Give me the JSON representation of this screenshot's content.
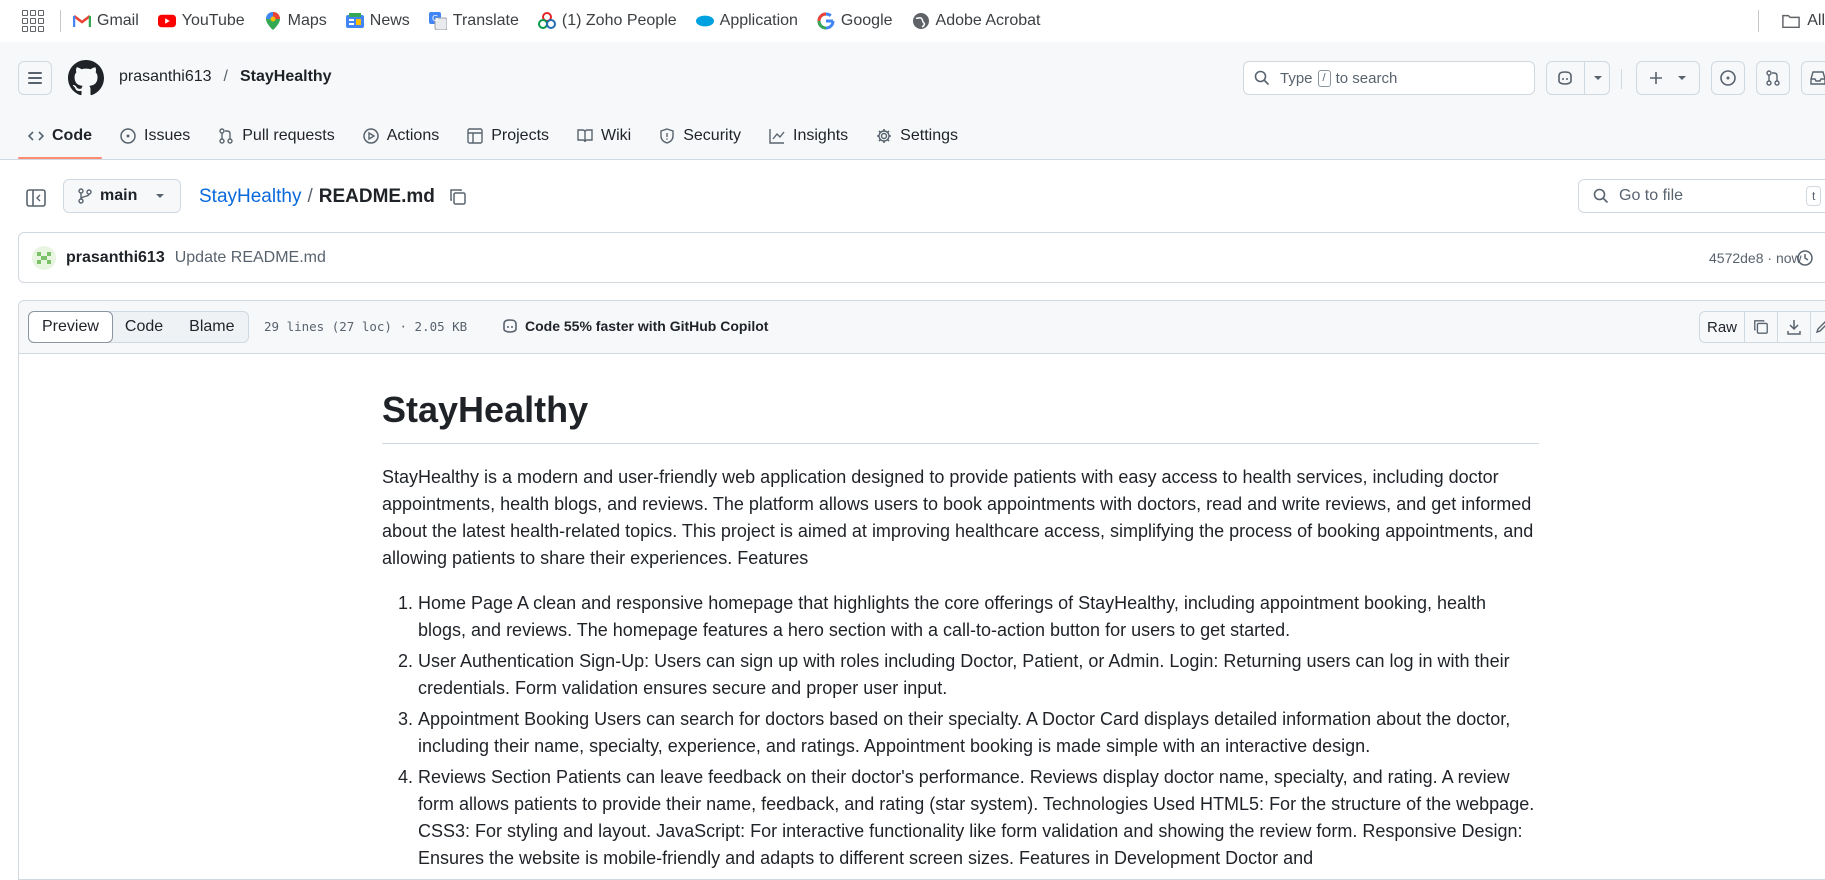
{
  "bookmarks": {
    "items": [
      {
        "label": "Gmail",
        "icon": "gmail-icon"
      },
      {
        "label": "YouTube",
        "icon": "youtube-icon"
      },
      {
        "label": "Maps",
        "icon": "maps-icon"
      },
      {
        "label": "News",
        "icon": "news-icon"
      },
      {
        "label": "Translate",
        "icon": "translate-icon"
      },
      {
        "label": "(1) Zoho People",
        "icon": "zoho-icon"
      },
      {
        "label": "Application",
        "icon": "salesforce-icon"
      },
      {
        "label": "Google",
        "icon": "google-icon"
      },
      {
        "label": "Adobe Acrobat",
        "icon": "globe-icon"
      }
    ],
    "all_bookmarks": "All"
  },
  "header": {
    "owner": "prasanthi613",
    "separator": "/",
    "repo": "StayHealthy",
    "search_prefix": "Type",
    "search_key": "/",
    "search_suffix": "to search"
  },
  "tabs": [
    {
      "label": "Code",
      "icon": "code-icon",
      "active": true
    },
    {
      "label": "Issues",
      "icon": "issues-icon"
    },
    {
      "label": "Pull requests",
      "icon": "pull-request-icon"
    },
    {
      "label": "Actions",
      "icon": "actions-icon"
    },
    {
      "label": "Projects",
      "icon": "projects-icon"
    },
    {
      "label": "Wiki",
      "icon": "wiki-icon"
    },
    {
      "label": "Security",
      "icon": "shield-icon"
    },
    {
      "label": "Insights",
      "icon": "graph-icon"
    },
    {
      "label": "Settings",
      "icon": "gear-icon"
    }
  ],
  "filebar": {
    "branch": "main",
    "repo_link": "StayHealthy",
    "path_sep": "/",
    "file": "README.md",
    "goto_placeholder": "Go to file",
    "goto_key": "t"
  },
  "commit": {
    "user": "prasanthi613",
    "message": "Update README.md",
    "meta": "4572de8 · now"
  },
  "viewer": {
    "modes": [
      "Preview",
      "Code",
      "Blame"
    ],
    "selected_mode": "Preview",
    "file_info": "29 lines (27 loc) · 2.05 KB",
    "copilot": "Code 55% faster with GitHub Copilot",
    "raw_label": "Raw"
  },
  "readme": {
    "title": "StayHealthy",
    "intro": "StayHealthy is a modern and user-friendly web application designed to provide patients with easy access to health services, including doctor appointments, health blogs, and reviews. The platform allows users to book appointments with doctors, read and write reviews, and get informed about the latest health-related topics. This project is aimed at improving healthcare access, simplifying the process of booking appointments, and allowing patients to share their experiences. Features",
    "items": [
      "Home Page A clean and responsive homepage that highlights the core offerings of StayHealthy, including appointment booking, health blogs, and reviews. The homepage features a hero section with a call-to-action button for users to get started.",
      "User Authentication Sign-Up: Users can sign up with roles including Doctor, Patient, or Admin. Login: Returning users can log in with their credentials. Form validation ensures secure and proper user input.",
      "Appointment Booking Users can search for doctors based on their specialty. A Doctor Card displays detailed information about the doctor, including their name, specialty, experience, and ratings. Appointment booking is made simple with an interactive design.",
      "Reviews Section Patients can leave feedback on their doctor's performance. Reviews display doctor name, specialty, and rating. A review form allows patients to provide their name, feedback, and rating (star system). Technologies Used HTML5: For the structure of the webpage. CSS3: For styling and layout. JavaScript: For interactive functionality like form validation and showing the review form. Responsive Design: Ensures the website is mobile-friendly and adapts to different screen sizes. Features in Development Doctor and"
    ]
  },
  "colors": {
    "accent_link": "#0969da",
    "tab_underline": "#fd8c73",
    "border": "#d1d9e0"
  }
}
